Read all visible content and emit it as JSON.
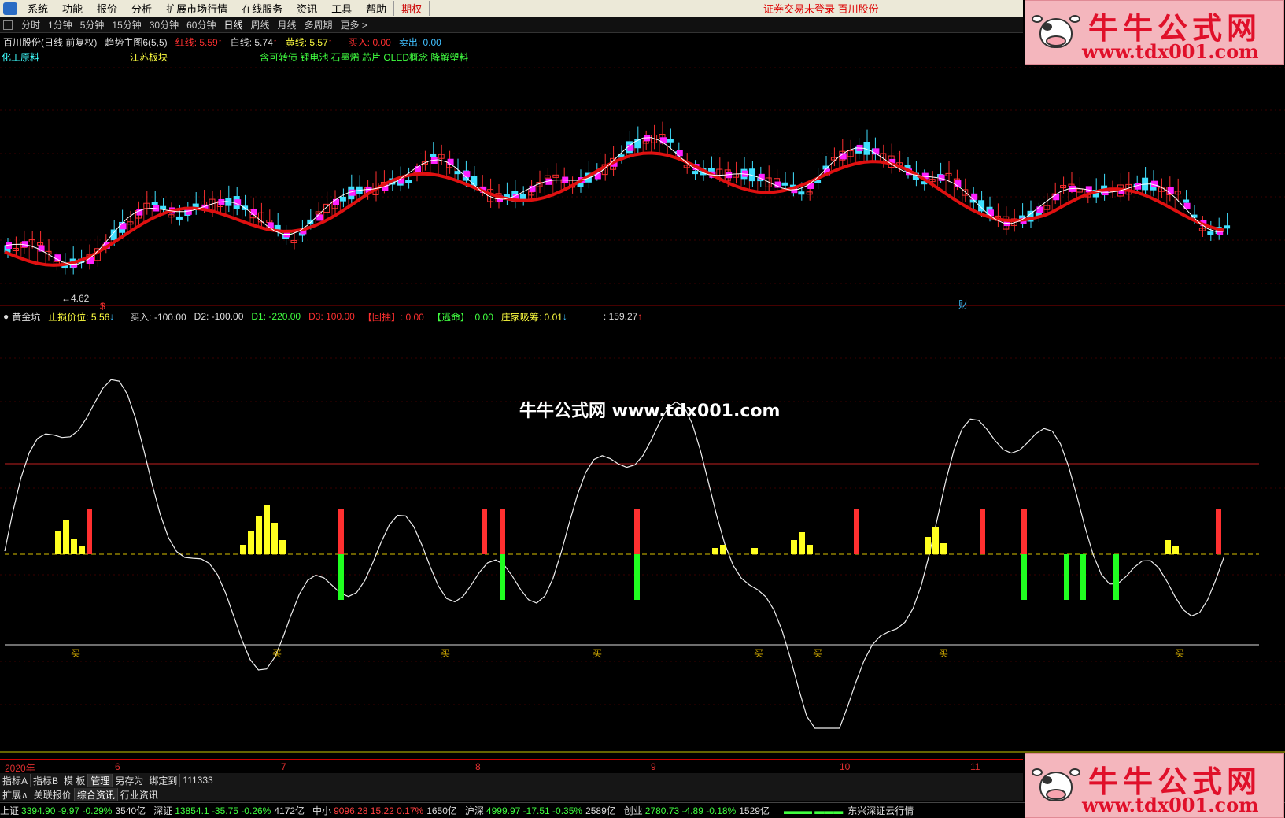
{
  "menu": {
    "items": [
      "系统",
      "功能",
      "报价",
      "分析",
      "扩展市场行情",
      "在线服务",
      "资讯",
      "工具",
      "帮助",
      "期权"
    ],
    "status": "证券交易未登录  百川股份"
  },
  "periods": [
    "分时",
    "1分钟",
    "5分钟",
    "15分钟",
    "30分钟",
    "60分钟",
    "日线",
    "周线",
    "月线",
    "多周期",
    "更多"
  ],
  "period_more_arrow": ">",
  "main_info": {
    "stock": "百川股份(日线 前复权)",
    "indicator": "趋势主图6(5,5)",
    "red_line": "红线: 5.59",
    "white_line": "白线: 5.74",
    "yellow_line": "黄线: 5.57",
    "buy": "买入: 0.00",
    "sell": "卖出: 0.00",
    "arrow_up": "↑"
  },
  "sector_info": {
    "industry": "化工原料",
    "region": "江苏板块",
    "concepts": "含可转债 锂电池 石墨烯 芯片 OLED概念 降解塑料"
  },
  "sub_info": {
    "name": "黄金坑",
    "stop": "止损价位: 5.56",
    "buy": "买入: -100.00",
    "d2": "D2: -100.00",
    "d1": "D1: -220.00",
    "d3": "D3: 100.00",
    "huichou": "【回抽】: 0.00",
    "taoming": "【逃命】: 0.00",
    "zhuangjia": "庄家吸筹: 0.01",
    "value": ": 159.27",
    "arrow_down": "↓",
    "arrow_up": "↑"
  },
  "labels": {
    "low_price": "←4.62",
    "dollar": "$",
    "cai": "财",
    "buy_mark": "买"
  },
  "dates": [
    "2020年",
    "6",
    "7",
    "8",
    "9",
    "10",
    "11"
  ],
  "tabs1": [
    "指标A",
    "指标B",
    "模 板",
    "管理",
    "另存为",
    "绑定到",
    "111333"
  ],
  "tabs2": [
    "扩展∧",
    "关联报价",
    "综合资讯",
    "行业资讯"
  ],
  "ticker": [
    {
      "name": "上证",
      "price": "3394.90",
      "chg": "-9.97",
      "pct": "-0.29%",
      "vol": "3540亿",
      "dir": "dn"
    },
    {
      "name": "深证",
      "price": "13854.1",
      "chg": "-35.75",
      "pct": "-0.26%",
      "vol": "4172亿",
      "dir": "dn"
    },
    {
      "name": "中小",
      "price": "9096.28",
      "chg": "15.22",
      "pct": "0.17%",
      "vol": "1650亿",
      "dir": "up"
    },
    {
      "name": "沪深",
      "price": "4999.97",
      "chg": "-17.51",
      "pct": "-0.35%",
      "vol": "2589亿",
      "dir": "dn"
    },
    {
      "name": "创业",
      "price": "2780.73",
      "chg": "-4.89",
      "pct": "-0.18%",
      "vol": "1529亿",
      "dir": "dn"
    }
  ],
  "broker": "东兴深证云行情",
  "watermark": {
    "title": "牛牛公式网",
    "url": "www.tdx001.com"
  },
  "center_watermark": "牛牛公式网  www.tdx001.com",
  "colors": {
    "up": "#ff3030",
    "down": "#40e0ff",
    "magenta": "#ff20ff",
    "yellow": "#ffff20",
    "green": "#20ff20"
  }
}
